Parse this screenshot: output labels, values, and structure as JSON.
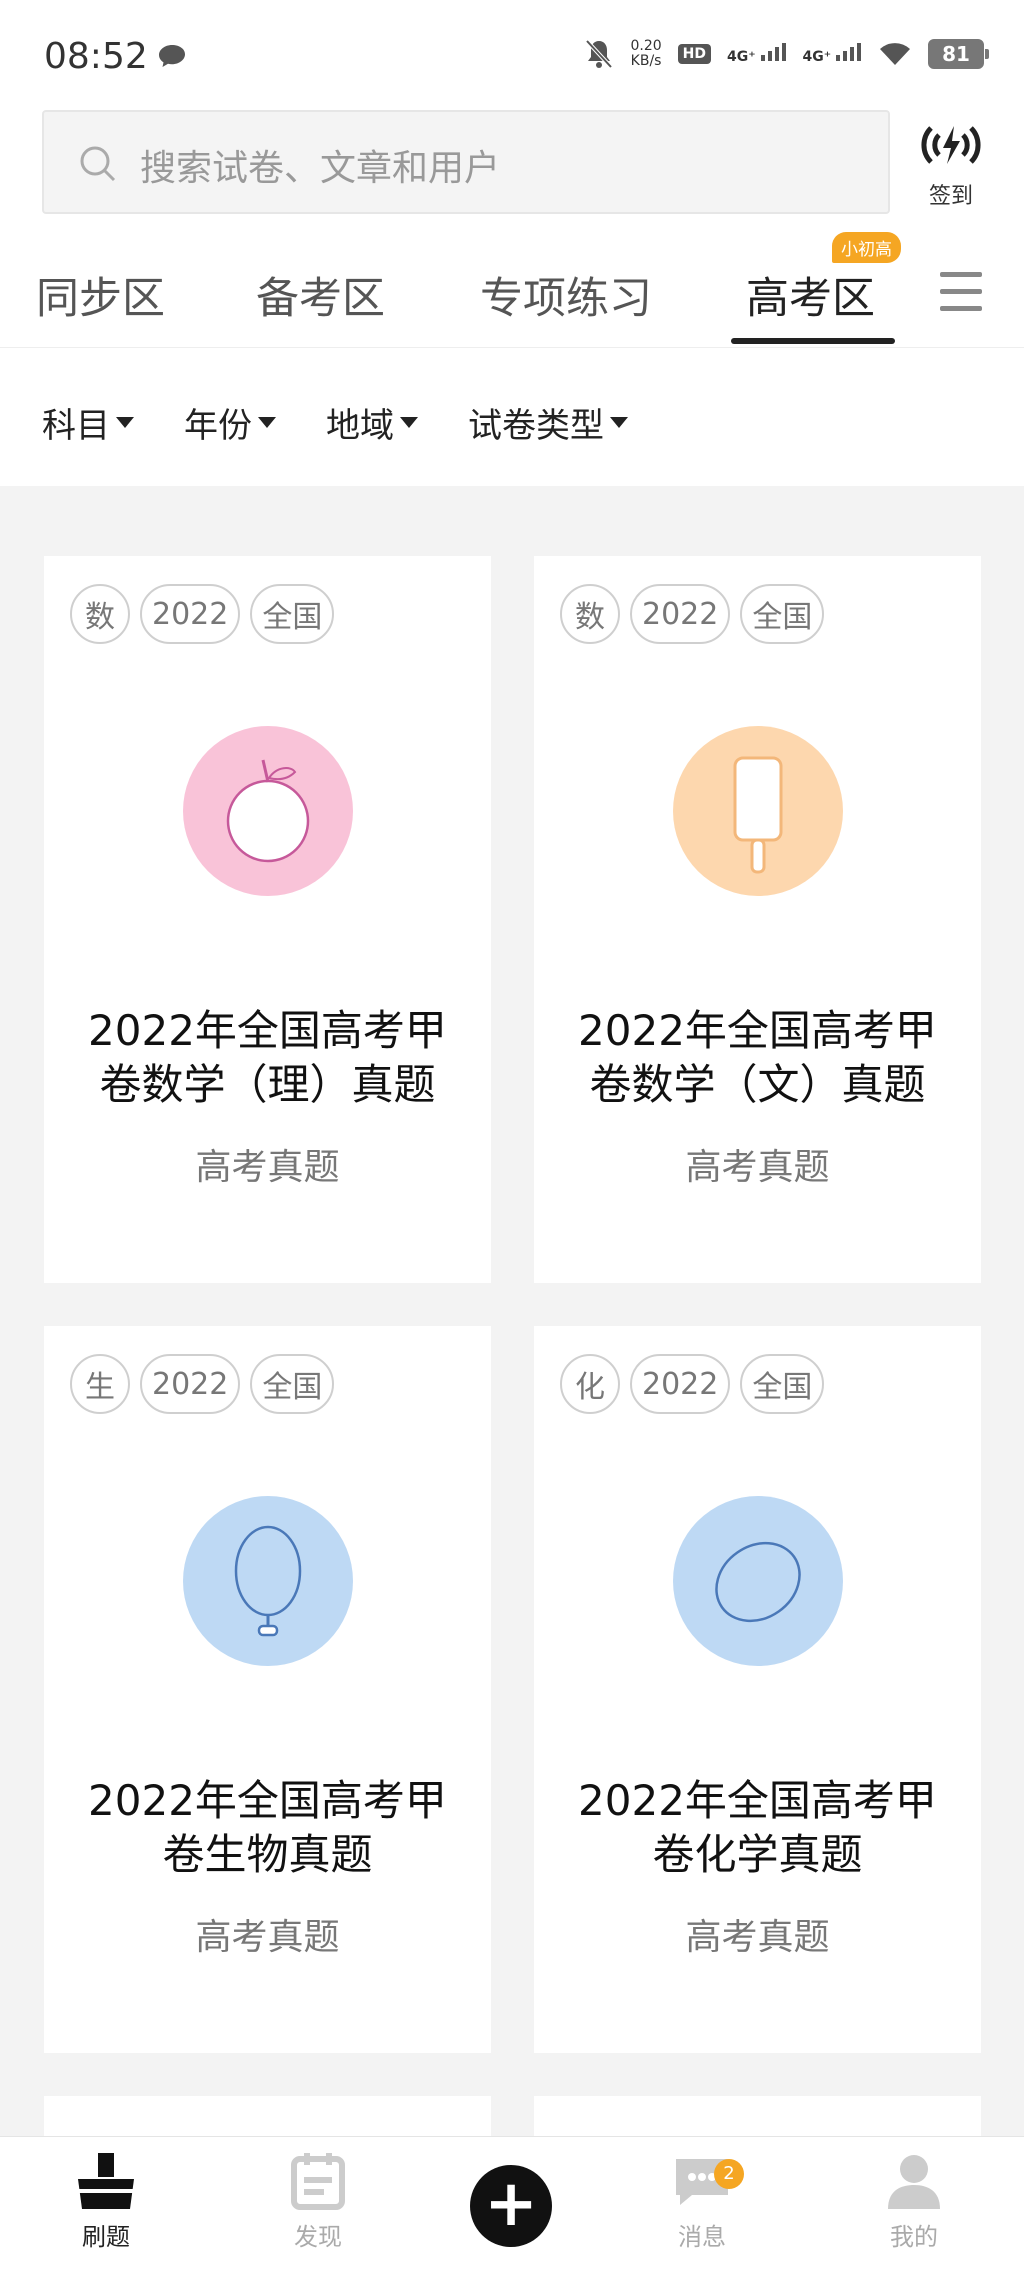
{
  "status_bar": {
    "time": "08:52",
    "net_speed_value": "0.20",
    "net_speed_unit": "KB/s",
    "hd_label": "HD",
    "signal1": "4G⁺",
    "signal2": "4G⁺",
    "battery": "81"
  },
  "search": {
    "placeholder": "搜索试卷、文章和用户"
  },
  "signin": {
    "label": "签到"
  },
  "tabs": [
    {
      "label": "同步区"
    },
    {
      "label": "备考区"
    },
    {
      "label": "专项练习"
    },
    {
      "label": "高考区",
      "badge": "小初高"
    }
  ],
  "filters": [
    {
      "label": "科目"
    },
    {
      "label": "年份"
    },
    {
      "label": "地域"
    },
    {
      "label": "试卷类型"
    }
  ],
  "cards": [
    {
      "tags": [
        "数",
        "2022",
        "全国"
      ],
      "icon": "apple-icon",
      "color": "#f9c3d8",
      "title_line1": "2022年全国高考甲",
      "title_line2": "卷数学（理）真题",
      "subtitle": "高考真题"
    },
    {
      "tags": [
        "数",
        "2022",
        "全国"
      ],
      "icon": "popsicle-icon",
      "color": "#fdd7ae",
      "title_line1": "2022年全国高考甲",
      "title_line2": "卷数学（文）真题",
      "subtitle": "高考真题"
    },
    {
      "tags": [
        "生",
        "2022",
        "全国"
      ],
      "icon": "balloon-icon",
      "color": "#bed9f4",
      "title_line1": "2022年全国高考甲",
      "title_line2": "卷生物真题",
      "subtitle": "高考真题"
    },
    {
      "tags": [
        "化",
        "2022",
        "全国"
      ],
      "icon": "egg-icon",
      "color": "#bed9f4",
      "title_line1": "2022年全国高考甲",
      "title_line2": "卷化学真题",
      "subtitle": "高考真题"
    }
  ],
  "bottom_nav": [
    {
      "label": "刷题",
      "icon": "brush-icon",
      "active": true
    },
    {
      "label": "发现",
      "icon": "calendar-icon",
      "active": false
    },
    {
      "label": "",
      "icon": "plus-icon",
      "active": false
    },
    {
      "label": "消息",
      "icon": "chat-bubble-icon",
      "active": false,
      "badge": "2"
    },
    {
      "label": "我的",
      "icon": "user-icon",
      "active": false
    }
  ]
}
